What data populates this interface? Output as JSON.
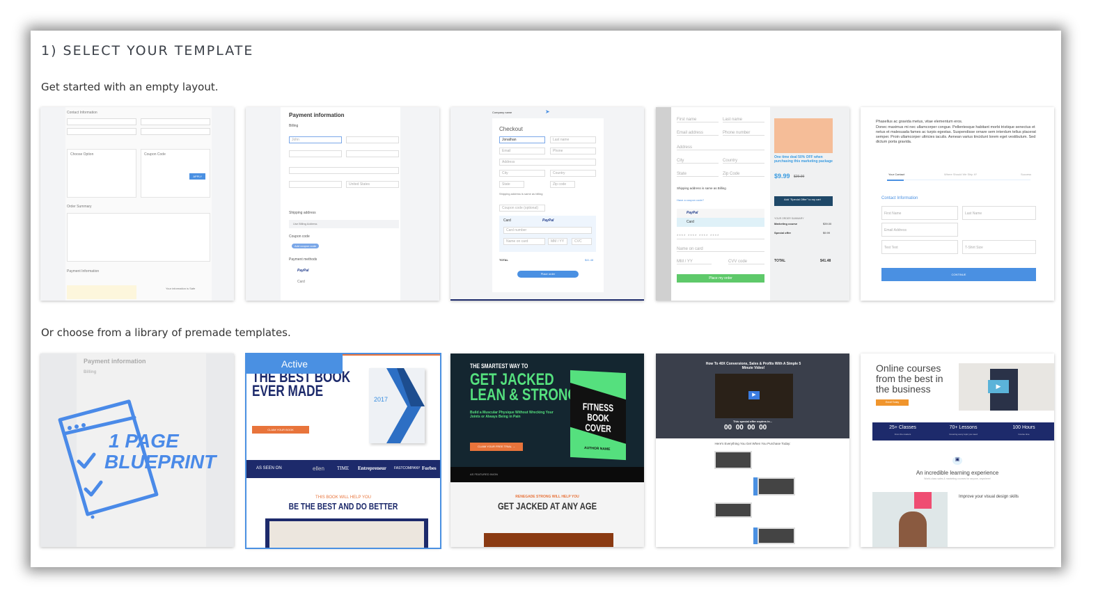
{
  "header": {
    "title": "1) SELECT YOUR TEMPLATE",
    "empty_label": "Get started with an empty layout.",
    "premade_label": "Or choose from a library of premade templates."
  },
  "empty_templates": [
    {
      "contact": "Contact Information",
      "choose_option": "Choose Option",
      "coupon": "Coupon Code",
      "apply": "APPLY",
      "order_summary": "Order Summary",
      "payment": "Payment Information",
      "safe": "Your information is Safe"
    },
    {
      "title": "Payment information",
      "billing": "Billing",
      "first": "John",
      "country": "United States",
      "shipping": "Shipping address",
      "use_billing": "Use Billing Address",
      "coupon": "Coupon code",
      "add_coupon": "Add coupon code",
      "methods": "Payment methods",
      "paypal": "PayPal",
      "card": "Card"
    },
    {
      "company": "Company name",
      "checkout": "Checkout",
      "first": "Jonathan",
      "last": "Last name",
      "email": "Email",
      "phone": "Phone",
      "address": "Address",
      "city": "City",
      "country": "Country",
      "state": "State",
      "zip": "Zip code",
      "shipping_same": "Shipping address is same as billing",
      "coupon": "Coupon code (optional)",
      "card": "Card",
      "paypal": "PayPal",
      "card_number": "Card number",
      "name_on_card": "Name on card",
      "mmyy": "MM / YY",
      "cvc": "CVC",
      "total": "TOTAL",
      "total_value": "$41.48",
      "place": "Place order"
    },
    {
      "first": "First name",
      "last": "Last name",
      "email": "Email address",
      "phone": "Phone number",
      "address": "Address",
      "city": "City",
      "country": "Country",
      "state": "State",
      "zip": "Zip Code",
      "shipping_same": "Shipping address is same as Billing",
      "coupon": "Have a coupon code?",
      "paypal": "PayPal",
      "card": "Card",
      "card_mask": "**** **** **** ****",
      "name_on_card": "Name on card",
      "mmyy": "MM / YY",
      "cvv": "CVV code",
      "place": "Place my order",
      "deal": "One time deal 50% OFF when purchasing this marketing package",
      "price": "$9.99",
      "old_price": "$29.99",
      "add_offer": "Add \"Special Offer\" to my cart",
      "summary": "YOUR ORDER SUMMARY",
      "items": [
        {
          "name": "Marketing course",
          "price": "$39.00"
        },
        {
          "name": "Special offer",
          "price": "$9.99"
        }
      ],
      "total": "TOTAL",
      "total_value": "$41.48"
    },
    {
      "para1": "Phasellus ac gravida metus, vitae elementum eros.",
      "para2": "Donec maximus mi nec ullamcorper congue. Pellentesque habitant morbi tristique senectus et netus et malesuada fames ac turpis egestas. Suspendisse ornare sem interdum tellus placerat semper. Proin ullamcorper ultricies iaculis. Aenean varius tincidunt lorem eget vestibulum. Sed dictum porta gravida.",
      "steps": [
        "Your Contact",
        "Where Should We Ship It?",
        "Success"
      ],
      "contact": "Contact Information",
      "fields": [
        "First Name",
        "Last Name",
        "Email Address",
        "Test Text",
        "T-Shirt Size"
      ],
      "continue": "CONTINUE"
    }
  ],
  "premade_templates": [
    {
      "logo": "1 PAGE BLUEPRINT",
      "logo_line1": "1 PAGE",
      "logo_line2": "BLUEPRINT",
      "bg_title": "Payment information",
      "bg_billing": "Billing"
    },
    {
      "active_badge": "Active",
      "headline1": "THE BEST BOOK",
      "headline2": "EVER MADE",
      "cta": "CLAIM YOUR BOOK",
      "book_year": "2017",
      "as_seen": "AS SEEN ON",
      "logos": [
        "ellen",
        "TIME",
        "Entrepreneur",
        "FASTCOMPANY",
        "Forbes"
      ],
      "kicker": "THIS BOOK WILL HELP YOU",
      "headline3": "BE THE BEST AND DO BETTER"
    },
    {
      "pre": "THE SMARTEST WAY TO",
      "headline1": "GET JACKED",
      "headline2": "LEAN & STRONG",
      "sub": "Build a Muscular Physique Without Wrecking Your Joints or Always Being in Pain",
      "cta": "CLAIM YOUR FREE TRIAL →",
      "book": "FITNESS BOOK COVER",
      "author": "AUTHOR NAME",
      "featured": "AS FEATURED IN/ON",
      "kicker": "RENEGADE STRONG WILL HELP YOU",
      "headline3": "GET JACKED AT ANY AGE"
    },
    {
      "headline": "How To 40X Conversions, Sales & Profits With A Simple 5 Minute Video!",
      "expires": "This special offer expires in...",
      "timer": [
        "00",
        "00",
        "00",
        "00"
      ],
      "everything": "Here's Everything You Get When You Purchase Today:"
    },
    {
      "headline": "Online courses from the best in the business",
      "cta": "Enroll Today",
      "stats": [
        {
          "value": "25+ Classes",
          "sub": "From the masters"
        },
        {
          "value": "70+ Lessons",
          "sub": "Covering every topic you need"
        },
        {
          "value": "100 Hours",
          "sub": "Course time"
        }
      ],
      "section": "An incredible learning experience",
      "section_sub": "World-class sales & marketing courses for anyone, anywhere!",
      "skills": "Improve your visual design skills"
    }
  ],
  "colors": {
    "accent": "#4a90e2",
    "navy": "#1d2a6b",
    "orange": "#e8743b",
    "green": "#5ec96a",
    "fitness_green": "#55e07e",
    "dark": "#3a3f4b"
  }
}
